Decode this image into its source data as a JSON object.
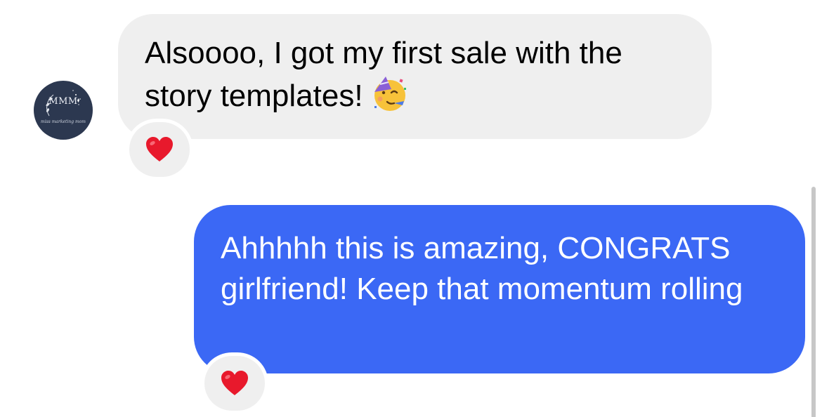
{
  "conversation": {
    "incoming": {
      "avatar": {
        "monogram": "MMM",
        "caption": "miss marketing mom"
      },
      "text": "Alsoooo, I got my first sale with the story templates!",
      "emoji": "partying-face-emoji",
      "reaction": "red-heart-icon"
    },
    "outgoing": {
      "text": "Ahhhhh this is amazing, CONGRATS girlfriend! Keep that momentum rolling",
      "reaction": "red-heart-icon"
    }
  },
  "colors": {
    "incoming_bubble": "#efefef",
    "outgoing_bubble": "#3b68f5",
    "avatar_bg": "#2c3850",
    "heart": "#e8192c"
  }
}
